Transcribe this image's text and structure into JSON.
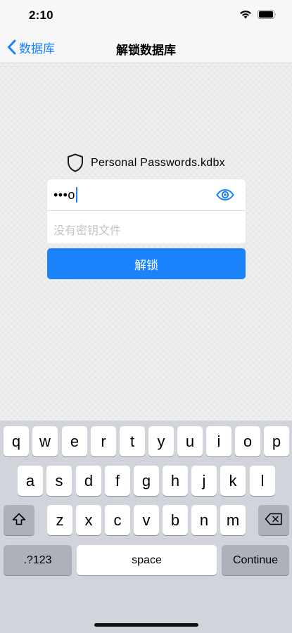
{
  "status_bar": {
    "time": "2:10",
    "wifi_icon": "wifi-icon",
    "battery_icon": "battery-icon"
  },
  "nav": {
    "back_label": "数据库",
    "title": "解锁数据库"
  },
  "database": {
    "icon": "shield-icon",
    "filename": "Personal Passwords.kdbx"
  },
  "password_field": {
    "masked_value": "•••o",
    "reveal_icon": "eye-icon"
  },
  "keyfile_field": {
    "placeholder": "没有密钥文件"
  },
  "unlock_button": {
    "label": "解锁"
  },
  "keyboard": {
    "row1": [
      "q",
      "w",
      "e",
      "r",
      "t",
      "y",
      "u",
      "i",
      "o",
      "p"
    ],
    "row2": [
      "a",
      "s",
      "d",
      "f",
      "g",
      "h",
      "j",
      "k",
      "l"
    ],
    "row3": [
      "z",
      "x",
      "c",
      "v",
      "b",
      "n",
      "m"
    ],
    "numbers_label": ".?123",
    "space_label": "space",
    "return_label": "Continue",
    "shift_icon": "shift-icon",
    "delete_icon": "delete-icon"
  },
  "colors": {
    "accent": "#1a82fb",
    "keyboard_bg": "#d1d4da",
    "function_key": "#acb1ba"
  }
}
